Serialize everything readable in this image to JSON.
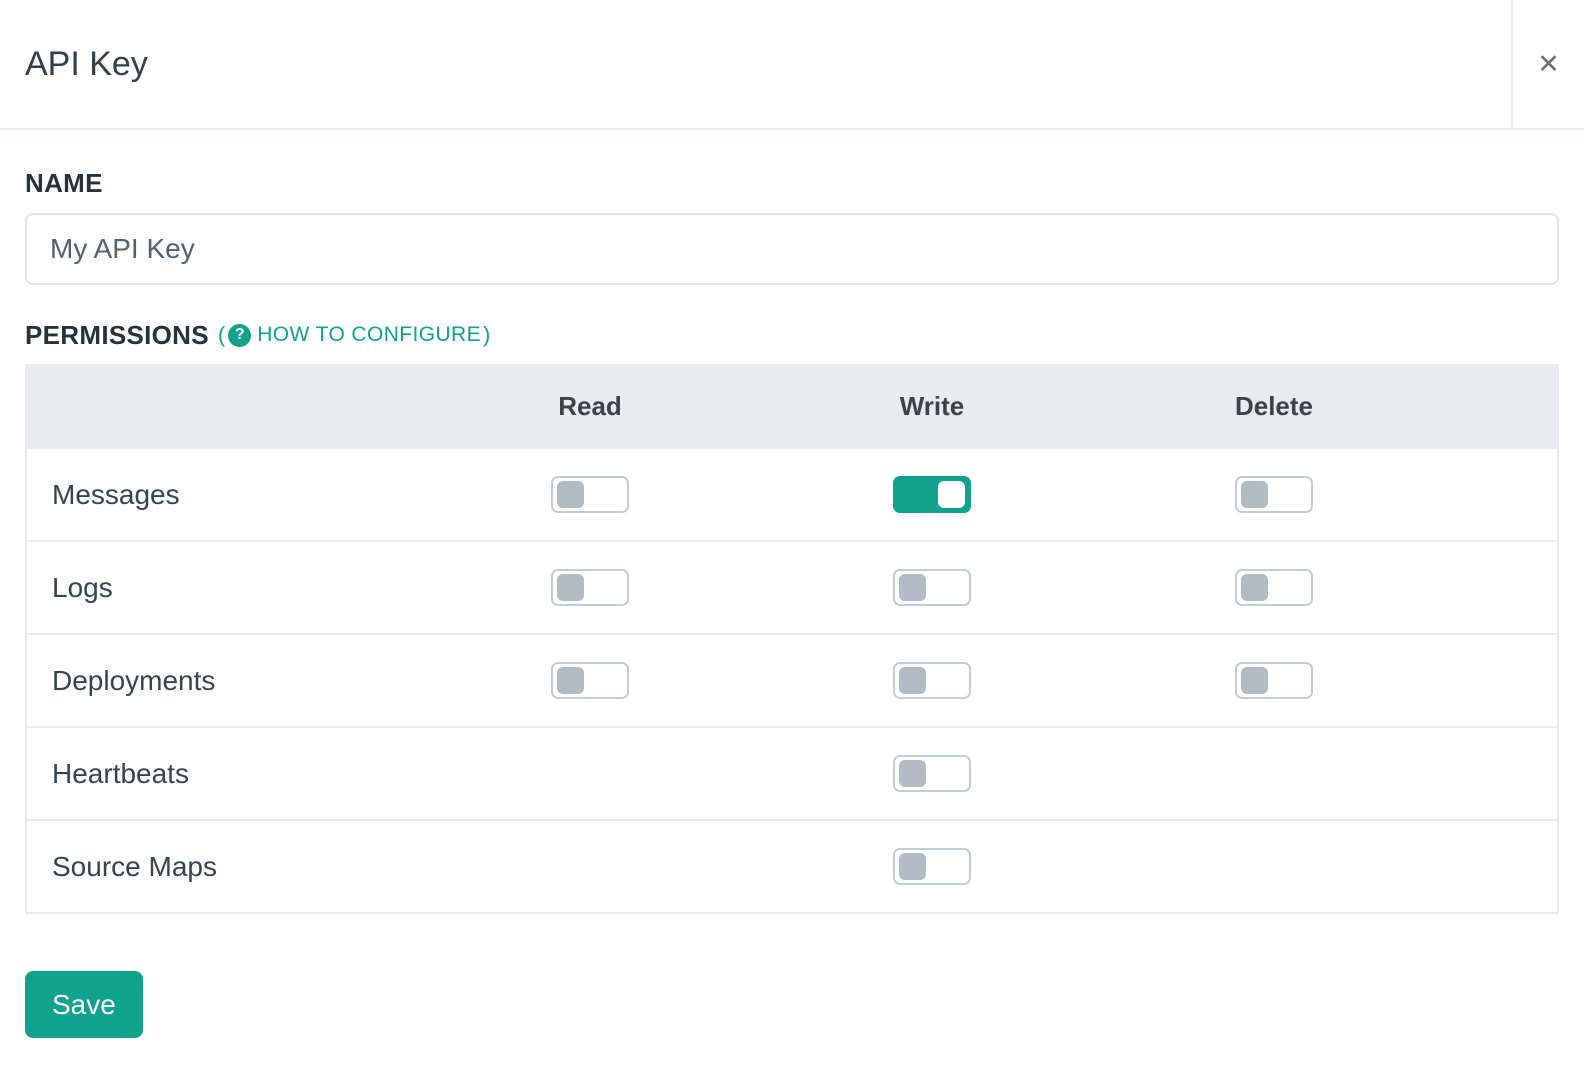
{
  "modal": {
    "title": "API Key",
    "close_icon": "✕"
  },
  "form": {
    "name_label": "NAME",
    "name_input": {
      "value": "",
      "placeholder": "My API Key"
    },
    "permissions_heading": {
      "label": "PERMISSIONS",
      "paren_open": "(",
      "help_icon": "?",
      "help_link": "HOW TO CONFIGURE",
      "paren_close": ")"
    }
  },
  "table": {
    "columns": [
      "Read",
      "Write",
      "Delete"
    ],
    "rows": [
      {
        "label": "Messages",
        "read": "off",
        "write": "on",
        "delete": "off"
      },
      {
        "label": "Logs",
        "read": "off",
        "write": "off",
        "delete": "off"
      },
      {
        "label": "Deployments",
        "read": "off",
        "write": "off",
        "delete": "off"
      },
      {
        "label": "Heartbeats",
        "read": null,
        "write": "off",
        "delete": null
      },
      {
        "label": "Source Maps",
        "read": null,
        "write": "off",
        "delete": null
      }
    ]
  },
  "actions": {
    "save_label": "Save"
  },
  "colors": {
    "accent": "#10a28c",
    "toggle_off_knob": "#b2bac3",
    "table_header_bg": "#e9ebee"
  }
}
